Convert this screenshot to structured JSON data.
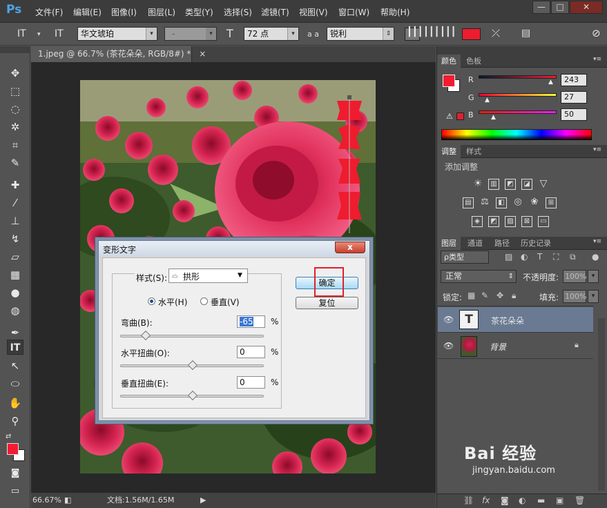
{
  "app": {
    "logo": "Ps"
  },
  "menu": [
    "文件(F)",
    "编辑(E)",
    "图像(I)",
    "图层(L)",
    "类型(Y)",
    "选择(S)",
    "滤镜(T)",
    "视图(V)",
    "窗口(W)",
    "帮助(H)"
  ],
  "window_controls": {
    "minimize": "—",
    "restore": "□",
    "close": "✕"
  },
  "options": {
    "tool_icon": "IT",
    "orient_icon": "IT",
    "font_family": "华文琥珀",
    "font_style": "-",
    "size_icon": "T",
    "font_size": "72 点",
    "aa_icon": "a a",
    "antialias": "锐利",
    "text_color": "#ee1c2e"
  },
  "document": {
    "tab": "1.jpeg @ 66.7% (茶花朵朵, RGB/8#) *",
    "tab_close": "×",
    "zoom": "66.67%",
    "doc_info": "文档:1.56M/1.65M",
    "vertical_text": "茶花朵朵"
  },
  "color_panel": {
    "tabs": [
      "颜色",
      "色板"
    ],
    "channels": [
      {
        "label": "R",
        "value": "243"
      },
      {
        "label": "G",
        "value": "27"
      },
      {
        "label": "B",
        "value": "50"
      }
    ],
    "foreground": "#f31b32"
  },
  "adjust_panel": {
    "tabs": [
      "调整",
      "样式"
    ],
    "title": "添加调整"
  },
  "layers_panel": {
    "tabs": [
      "图层",
      "通道",
      "路径",
      "历史记录"
    ],
    "filter": "ρ类型",
    "blend_mode": "正常",
    "opacity_label": "不透明度:",
    "opacity_value": "100%",
    "lock_label": "锁定:",
    "fill_label": "填充:",
    "fill_value": "100%",
    "layers": [
      {
        "name": "茶花朵朵",
        "type_icon": "T"
      },
      {
        "name": "背景"
      }
    ],
    "footer_icons": [
      "link-icon",
      "fx-icon",
      "mask-icon",
      "adjustment-icon",
      "group-icon",
      "new-layer-icon",
      "delete-icon"
    ],
    "fx_label": "fx"
  },
  "dialog": {
    "title": "变形文字",
    "close": "x",
    "style_label": "样式(S):",
    "style_value": "拱形",
    "horizontal_label": "水平(H)",
    "vertical_label": "垂直(V)",
    "bend_label": "弯曲(B):",
    "bend_value": "-65",
    "bend_level": -65,
    "hdist_label": "水平扭曲(O):",
    "hdist_value": "0",
    "hdist_level": 0,
    "vdist_label": "垂直扭曲(E):",
    "vdist_value": "0",
    "vdist_level": 0,
    "percent": "%",
    "ok_label": "确定",
    "reset_label": "复位"
  },
  "watermark": {
    "brand": "Bai 经验",
    "url": "jingyan.baidu.com"
  }
}
